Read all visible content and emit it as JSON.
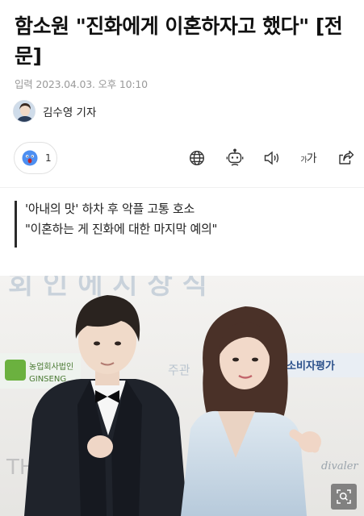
{
  "article": {
    "headline": "함소원 \"진화에게 이혼하자고 했다\" [전문]",
    "dateline": "입력 2023.04.03. 오후 10:10",
    "author": "김수영 기자"
  },
  "toolbar": {
    "reaction_count": "1",
    "fontsize_label_small": "가",
    "fontsize_label_large": "가",
    "icons": [
      "globe-icon",
      "robot-icon",
      "speaker-icon",
      "font-size-icon",
      "share-icon"
    ]
  },
  "summary": {
    "lines": [
      "'아내의 맛' 하차 후 악플 고통 호소",
      "\"이혼하는 게 진화에 대한 마지막 예의\""
    ]
  },
  "photo": {
    "backdrop_text": "회 인 에  시 상 식",
    "sponsor_1": "농업회사법인",
    "sponsor_2": "GINSENG",
    "sponsor_3": "주관",
    "sponsor_4": "소비자평가",
    "sponsor_5": "TH",
    "sponsor_6": "divaler"
  },
  "colors": {
    "headline": "#111111",
    "meta": "#9a9a9a",
    "accent_bar": "#2a2a2a"
  }
}
